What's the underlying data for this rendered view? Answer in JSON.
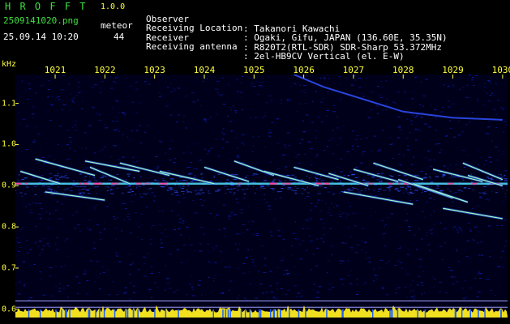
{
  "header": {
    "app_title": "H R O F F T",
    "version": "1.0.0",
    "filename": "2509141020.png",
    "datetime": "25.09.14 10:20",
    "meteor_label": "meteor",
    "meteor_count": "44",
    "info": [
      {
        "label": "Observer",
        "value": ": Takanori Kawachi"
      },
      {
        "label": "Receiving Location",
        "value": ": Ogaki, Gifu, JAPAN (136.60E, 35.35N)"
      },
      {
        "label": "Receiver",
        "value": ": R820T2(RTL-SDR) SDR-Sharp 53.372MHz"
      },
      {
        "label": "Receiving antenna",
        "value": ": 2el-HB9CV Vertical (el. E-W)"
      }
    ]
  },
  "chart_data": {
    "type": "heatmap",
    "x_ticks": [
      "1021",
      "1022",
      "1023",
      "1024",
      "1025",
      "1026",
      "1027",
      "1028",
      "1029",
      "1030"
    ],
    "xlim": [
      1020.2,
      1030.1
    ],
    "ylabel": "kHz",
    "y_ticks": [
      "1.1",
      "1.0",
      "0.9",
      "0.8",
      "0.7",
      "0.6"
    ],
    "ylim": [
      0.58,
      1.17
    ],
    "baseline_khz": 0.905,
    "reference_lines_khz": [
      0.62,
      0.605
    ],
    "echoes": [
      {
        "x0": 1020.3,
        "y0": 0.935,
        "x1": 1021.1,
        "y1": 0.905
      },
      {
        "x0": 1020.6,
        "y0": 0.965,
        "x1": 1021.8,
        "y1": 0.925
      },
      {
        "x0": 1021.6,
        "y0": 0.96,
        "x1": 1022.7,
        "y1": 0.935
      },
      {
        "x0": 1021.7,
        "y0": 0.945,
        "x1": 1022.5,
        "y1": 0.905
      },
      {
        "x0": 1022.3,
        "y0": 0.955,
        "x1": 1023.3,
        "y1": 0.925
      },
      {
        "x0": 1023.1,
        "y0": 0.935,
        "x1": 1024.2,
        "y1": 0.905
      },
      {
        "x0": 1024.0,
        "y0": 0.945,
        "x1": 1024.9,
        "y1": 0.91
      },
      {
        "x0": 1024.6,
        "y0": 0.96,
        "x1": 1025.4,
        "y1": 0.925
      },
      {
        "x0": 1025.2,
        "y0": 0.935,
        "x1": 1026.3,
        "y1": 0.9
      },
      {
        "x0": 1025.8,
        "y0": 0.945,
        "x1": 1026.7,
        "y1": 0.915
      },
      {
        "x0": 1026.5,
        "y0": 0.93,
        "x1": 1027.3,
        "y1": 0.9
      },
      {
        "x0": 1027.0,
        "y0": 0.94,
        "x1": 1027.9,
        "y1": 0.91
      },
      {
        "x0": 1027.4,
        "y0": 0.955,
        "x1": 1028.4,
        "y1": 0.915
      },
      {
        "x0": 1027.9,
        "y0": 0.915,
        "x1": 1029.0,
        "y1": 0.87
      },
      {
        "x0": 1028.2,
        "y0": 0.905,
        "x1": 1029.3,
        "y1": 0.86
      },
      {
        "x0": 1028.6,
        "y0": 0.94,
        "x1": 1029.6,
        "y1": 0.91
      },
      {
        "x0": 1029.2,
        "y0": 0.955,
        "x1": 1030.0,
        "y1": 0.915
      },
      {
        "x0": 1029.3,
        "y0": 0.925,
        "x1": 1030.0,
        "y1": 0.9
      },
      {
        "x0": 1020.8,
        "y0": 0.885,
        "x1": 1022.0,
        "y1": 0.865
      },
      {
        "x0": 1026.8,
        "y0": 0.885,
        "x1": 1028.2,
        "y1": 0.855
      },
      {
        "x0": 1028.8,
        "y0": 0.845,
        "x1": 1030.0,
        "y1": 0.82
      }
    ],
    "long_echo": [
      [
        1025.8,
        1.17
      ],
      [
        1026.4,
        1.14
      ],
      [
        1027.2,
        1.11
      ],
      [
        1028.0,
        1.08
      ],
      [
        1029.0,
        1.065
      ],
      [
        1030.0,
        1.06
      ]
    ],
    "colors": {
      "background": "#00001a",
      "noise": "#1020d0",
      "baseline": "#50e0ff",
      "echo": "#a0ffc0",
      "peak": "#ff40a0",
      "power": "#f0e020",
      "ref_line": "#a0a0ff",
      "floor": "#2060ff"
    }
  }
}
